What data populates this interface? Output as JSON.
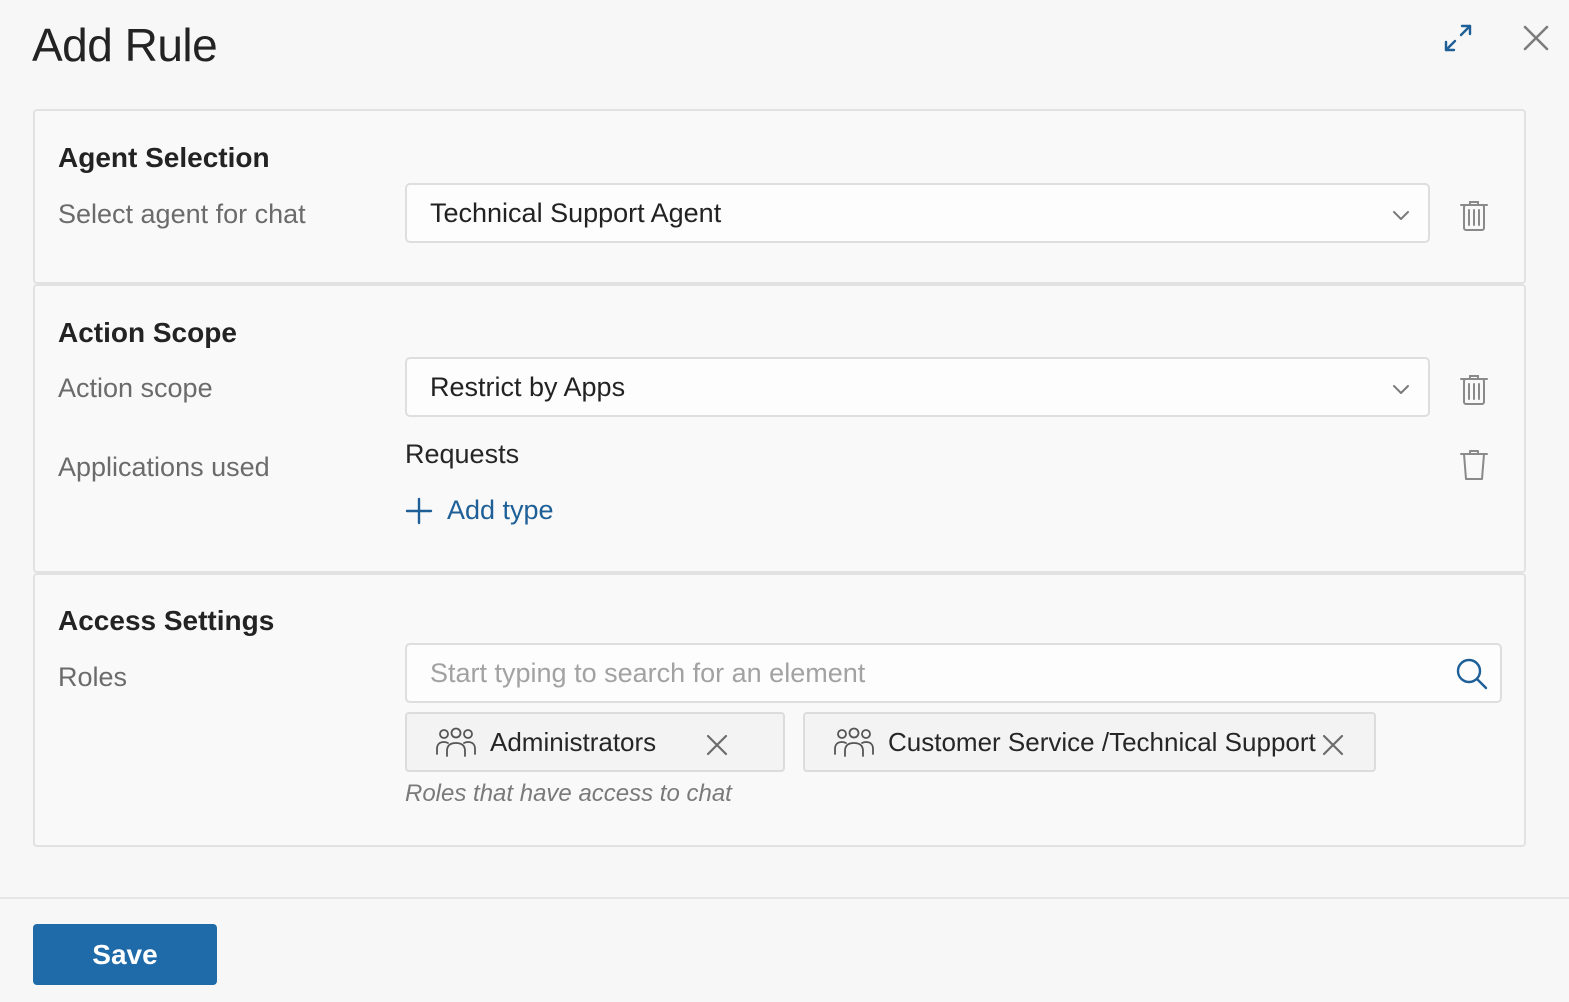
{
  "dialog": {
    "title": "Add Rule",
    "expand_icon": "expand-arrows-icon",
    "close_icon": "close-icon"
  },
  "agent_selection": {
    "title": "Agent Selection",
    "label": "Select agent for chat",
    "value": "Technical Support Agent"
  },
  "action_scope": {
    "title": "Action Scope",
    "scope_label": "Action scope",
    "scope_value": "Restrict by Apps",
    "apps_label": "Applications used",
    "apps": [
      "Requests"
    ],
    "add_type_label": "Add type"
  },
  "access_settings": {
    "title": "Access Settings",
    "roles_label": "Roles",
    "search_placeholder": "Start typing to search for an element",
    "chips": [
      {
        "label": "Administrators",
        "icon": "group-icon"
      },
      {
        "label": "Customer Service /Technical Support",
        "icon": "group-icon"
      }
    ],
    "hint": "Roles that have access to chat"
  },
  "footer": {
    "save_label": "Save"
  },
  "colors": {
    "accent": "#1f6aa8",
    "link": "#1d5f96",
    "background": "#f7f7f7"
  }
}
